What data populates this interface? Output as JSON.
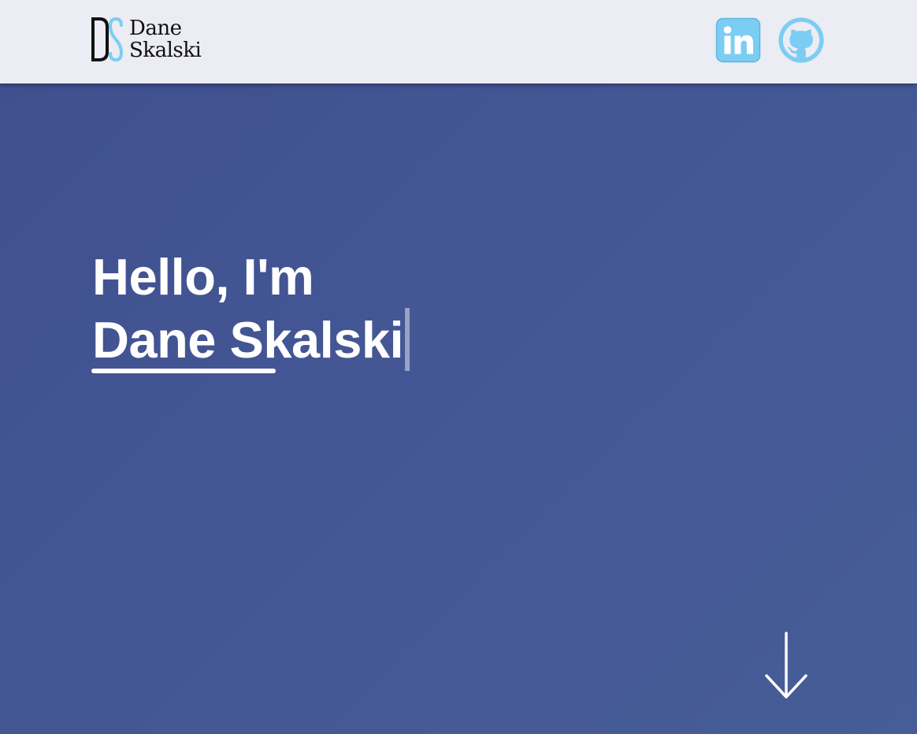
{
  "header": {
    "logo": {
      "monogram": "DS",
      "first_name": "Dane",
      "last_name": "Skalski",
      "colors": {
        "d": "#111111",
        "s": "#7ccdf3"
      }
    },
    "social": [
      {
        "name": "LinkedIn",
        "icon": "linkedin-icon",
        "color": "#7ccdf3"
      },
      {
        "name": "GitHub",
        "icon": "github-icon",
        "color": "#7ccdf3"
      }
    ]
  },
  "hero": {
    "greeting": "Hello, I'm",
    "name": "Dane Skalski",
    "scroll_icon": "arrow-down-icon"
  },
  "colors": {
    "header_bg": "#ebecf4",
    "hero_bg": "#435290",
    "accent": "#7ccdf3",
    "text": "#ffffff"
  }
}
